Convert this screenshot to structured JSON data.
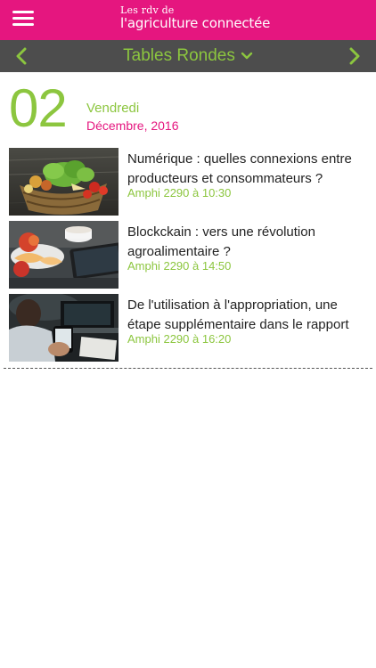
{
  "header": {
    "brand_line1": "Les rdv de",
    "brand_line2": "l'agriculture connectée",
    "brand_color": "#e5167f"
  },
  "nav": {
    "title": "Tables Rondes",
    "accent_color": "#8cc63f",
    "bar_color": "#4d4d4d"
  },
  "date": {
    "day": "02",
    "weekday": "Vendredi",
    "month_year": "Décembre, 2016"
  },
  "sessions": [
    {
      "title": "Numérique : quelles connexions entre producteurs et consommateurs ?",
      "meta": "Amphi 2290 à 10:30",
      "image": "vegetable-basket"
    },
    {
      "title": "Blockckain : vers une révolution agroalimentaire ?",
      "meta": "Amphi 2290 à 14:50",
      "image": "breakfast-tablet"
    },
    {
      "title": "De l'utilisation à l'appropriation, une étape supplémentaire dans le rapport",
      "meta": "Amphi 2290 à 16:20",
      "image": "person-smartphone"
    }
  ]
}
